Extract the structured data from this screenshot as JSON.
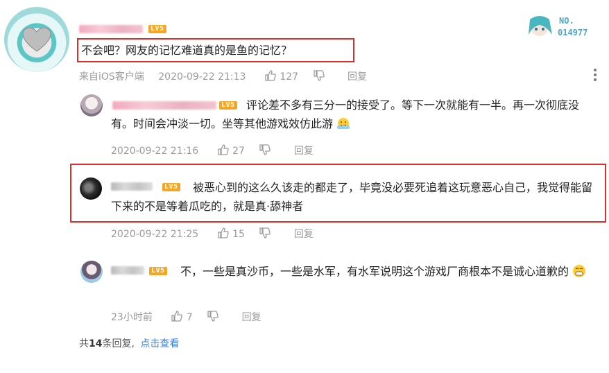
{
  "main_comment": {
    "badge": "LV5",
    "text": "不会吧？网友的记忆难道真的是鱼的记忆？",
    "source": "来自iOS客户端",
    "time": "2020-09-22 21:13",
    "likes": "127",
    "reply_label": "回复",
    "medal_no": "NO.",
    "medal_id": "014977"
  },
  "replies": [
    {
      "badge": "LV5",
      "text": "评论差不多有三分一的接受了。等下一次就能有一半。再一次彻底没有。时间会冲淡一切。坐等其他游戏效仿此游",
      "time": "2020-09-22 21:16",
      "likes": "27",
      "reply_label": "回复"
    },
    {
      "badge": "LV5",
      "text": "被恶心到的这么久该走的都走了，毕竟没必要死追着这玩意恶心自己，我觉得能留下来的不是等着瓜吃的，就是真·舔神者",
      "time": "2020-09-22 21:25",
      "likes": "15",
      "reply_label": "回复"
    },
    {
      "badge": "LV5",
      "text": "不，一些是真沙币，一些是水军，有水军说明这个游戏厂商根本不是诚心道歉的",
      "time": "23小时前",
      "likes": "7",
      "reply_label": "回复"
    }
  ],
  "footer": {
    "prefix": "共",
    "count": "14",
    "suffix": "条回复,",
    "link": "点击查看"
  },
  "colors": {
    "accent_link": "#3b7dd8",
    "highlight_box": "#d9302c",
    "level_badge": "#f5a623"
  }
}
